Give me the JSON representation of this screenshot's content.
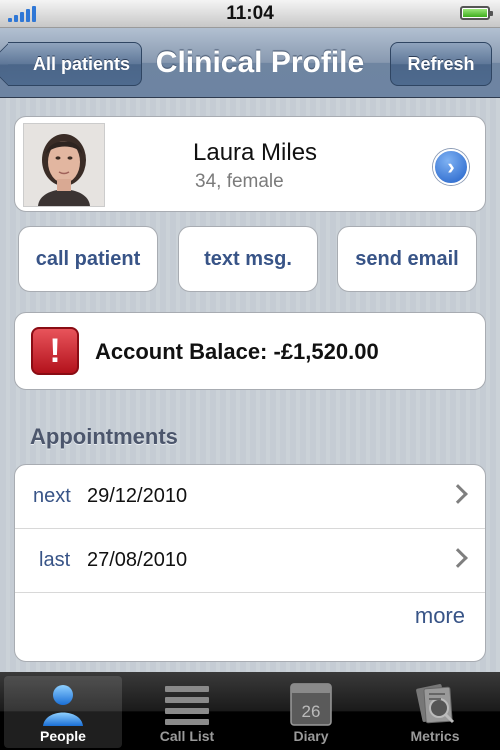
{
  "status_bar": {
    "time": "11:04"
  },
  "nav": {
    "title": "Clinical Profile",
    "back_label": "All patients",
    "refresh_label": "Refresh"
  },
  "patient": {
    "name": "Laura Miles",
    "details": "34, female"
  },
  "actions": {
    "call": "call patient",
    "text": "text msg.",
    "email": "send email"
  },
  "balance": {
    "text": "Account Balace: -£1,520.00"
  },
  "appointments": {
    "header": "Appointments",
    "rows": [
      {
        "label": "next",
        "date": "29/12/2010"
      },
      {
        "label": "last",
        "date": "27/08/2010"
      }
    ],
    "more": "more"
  },
  "tabs": [
    {
      "label": "People",
      "icon": "person-icon",
      "active": true
    },
    {
      "label": "Call List",
      "icon": "list-icon",
      "active": false
    },
    {
      "label": "Diary",
      "icon": "calendar-icon",
      "active": false,
      "badge": "26"
    },
    {
      "label": "Metrics",
      "icon": "metrics-icon",
      "active": false
    }
  ],
  "colors": {
    "accent_text": "#385487",
    "nav_bar": "#6f85a1",
    "alert_red": "#c81e28"
  }
}
